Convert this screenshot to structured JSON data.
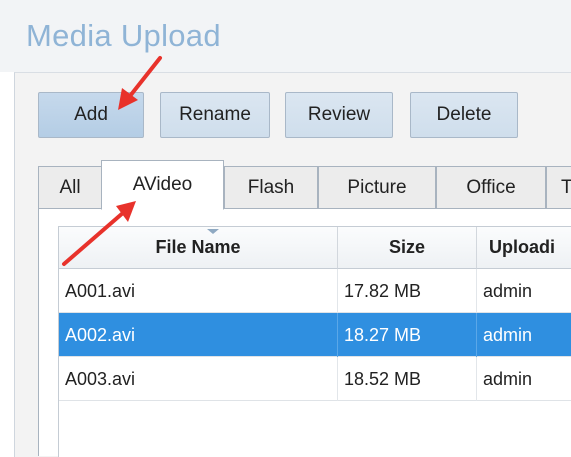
{
  "window": {
    "title": "Media Upload"
  },
  "toolbar": {
    "buttons": [
      {
        "label": "Add"
      },
      {
        "label": "Rename"
      },
      {
        "label": "Review"
      },
      {
        "label": "Delete"
      }
    ]
  },
  "tabs": [
    {
      "label": "All"
    },
    {
      "label": "AVideo",
      "active": true
    },
    {
      "label": "Flash"
    },
    {
      "label": "Picture"
    },
    {
      "label": "Office"
    },
    {
      "label": "T"
    }
  ],
  "table": {
    "columns": [
      "File Name",
      "Size",
      "Uploadi"
    ],
    "rows": [
      {
        "file": "A001.avi",
        "size": "17.82 MB",
        "uploader": "admin",
        "selected": false
      },
      {
        "file": "A002.avi",
        "size": "18.27 MB",
        "uploader": "admin",
        "selected": true
      },
      {
        "file": "A003.avi",
        "size": "18.52 MB",
        "uploader": "admin",
        "selected": false
      }
    ]
  },
  "colors": {
    "title": "#8fb4d6",
    "selection": "#2f8fe0",
    "annotation_arrow": "#e8322b"
  },
  "annotations": [
    "arrow pointing to Add button",
    "arrow pointing to AVideo tab"
  ]
}
